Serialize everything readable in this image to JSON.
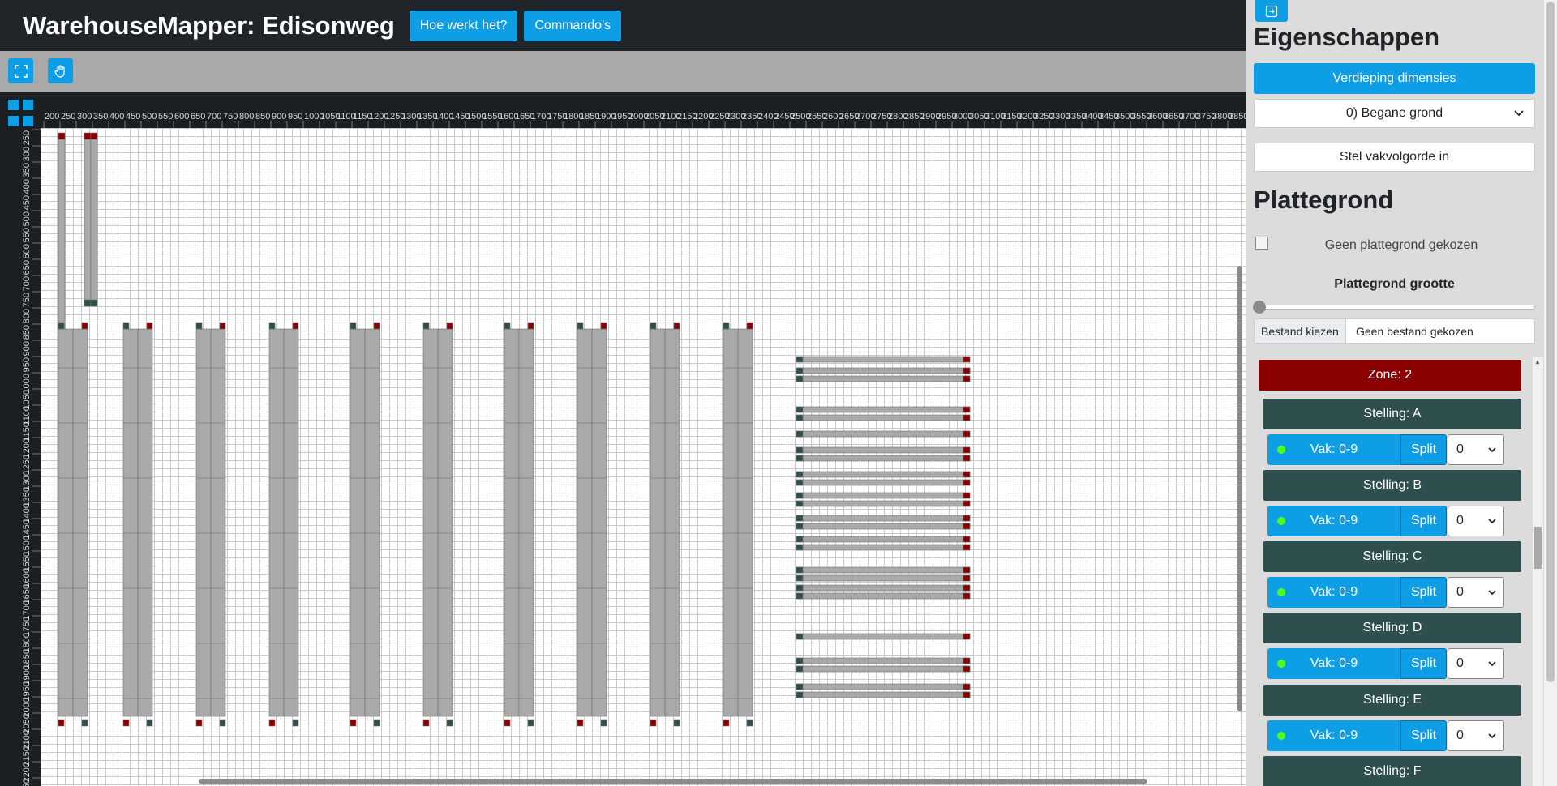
{
  "header": {
    "title": "WarehouseMapper: Edisonweg",
    "help_label": "Hoe werkt het?",
    "commands_label": "Commando's"
  },
  "toolbar": {
    "fit_icon": "fullscreen-icon",
    "pan_icon": "hand-icon"
  },
  "canvas": {
    "ruler_top_ticks": [
      "200",
      "250",
      "300",
      "350",
      "400",
      "450",
      "500",
      "550",
      "600",
      "650",
      "700",
      "750",
      "800",
      "850",
      "900",
      "950",
      "1000",
      "1050",
      "1100",
      "1150",
      "1200",
      "1250",
      "1300",
      "1350",
      "1400",
      "1450",
      "1500",
      "1550",
      "1600",
      "1650",
      "1700",
      "1750",
      "1800",
      "1850",
      "1900",
      "1950",
      "2000",
      "2050",
      "2100",
      "2150",
      "2200",
      "2250",
      "2300",
      "2350",
      "2400",
      "2450",
      "2500",
      "2550",
      "2600",
      "2650",
      "2700",
      "2750",
      "2800",
      "2850",
      "2900",
      "2950",
      "3000",
      "3050",
      "3100",
      "3150",
      "3200",
      "3250",
      "3300",
      "3350",
      "3400",
      "3450",
      "3500",
      "3550",
      "3600",
      "3650",
      "3700",
      "3750",
      "3800",
      "3850"
    ],
    "ruler_left_ticks": [
      "250",
      "300",
      "350",
      "400",
      "450",
      "500",
      "550",
      "600",
      "650",
      "700",
      "750",
      "800",
      "850",
      "900",
      "950",
      "1000",
      "1050",
      "1100",
      "1150",
      "1200",
      "1250",
      "1300",
      "1350",
      "1400",
      "1450",
      "1500",
      "1550",
      "1600",
      "1650",
      "1700",
      "1750",
      "1800",
      "1850",
      "1900",
      "1950",
      "2000",
      "2050",
      "2100",
      "2150",
      "2200",
      "2250"
    ],
    "colors": {
      "rack": "#a9a9a9",
      "marker_dark": "#2f4f4f",
      "marker_red": "#8b0000"
    }
  },
  "sidebar": {
    "collapse_icon": "collapse-right-icon",
    "properties_title": "Eigenschappen",
    "floor_dimensions_label": "Verdieping dimensies",
    "floor_select_value": "0) Begane grond",
    "set_order_label": "Stel vakvolgorde in",
    "floorplan_title": "Plattegrond",
    "floorplan_alt": "Geen plattegrond gekozen",
    "floorplan_size_label": "Plattegrond grootte",
    "floorplan_size_value": 0,
    "file_button_label": "Bestand kiezen",
    "file_name": "Geen bestand gekozen",
    "zone_label": "Zone: 2",
    "stellingen": [
      {
        "label": "Stelling: A",
        "vak_label": "Vak: 0-9",
        "split_label": "Split",
        "select_value": "0"
      },
      {
        "label": "Stelling: B",
        "vak_label": "Vak: 0-9",
        "split_label": "Split",
        "select_value": "0"
      },
      {
        "label": "Stelling: C",
        "vak_label": "Vak: 0-9",
        "split_label": "Split",
        "select_value": "0"
      },
      {
        "label": "Stelling: D",
        "vak_label": "Vak: 0-9",
        "split_label": "Split",
        "select_value": "0"
      },
      {
        "label": "Stelling: E",
        "vak_label": "Vak: 0-9",
        "split_label": "Split",
        "select_value": "0"
      },
      {
        "label": "Stelling: F"
      }
    ]
  }
}
